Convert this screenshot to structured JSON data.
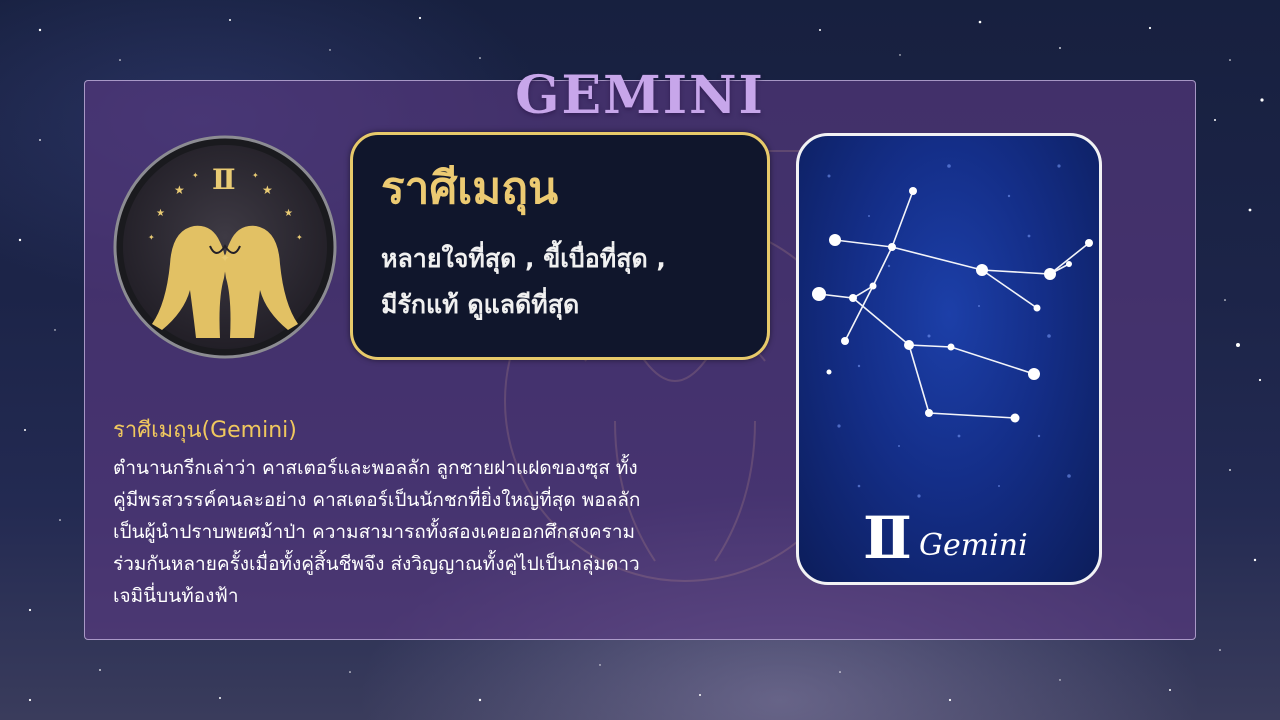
{
  "page": {
    "title": "GEMINI"
  },
  "traits_box": {
    "title": "ราศีเมถุน",
    "line1": "หลายใจที่สุด , ขี้เบื่อที่สุด ,",
    "line2": "มีรักแท้ ดูแลดีที่สุด"
  },
  "emblem": {
    "symbol": "♊"
  },
  "constellation_card": {
    "symbol": "Ⅱ",
    "name": "Gemini"
  },
  "description": {
    "heading": "ราศีเมถุน(Gemini)",
    "body": "ตำนานกรีกเล่าว่า คาสเตอร์และพอลลัก ลูกชายฝาแฝดของซุส ทั้ง\nคู่มีพรสวรรค์คนละอย่าง คาสเตอร์เป็นนักชกที่ยิ่งใหญ่ที่สุด พอลลัก\nเป็นผู้นำปราบพยศม้าป่า ความสามารถทั้งสองเคยออกศึกสงคราม\nร่วมกันหลายครั้งเมื่อทั้งคู่สิ้นชีพจึง ส่งวิญญาณทั้งคู่ไปเป็นกลุ่มดาว\nเจมินี่บนท้องฟ้า"
  },
  "colors": {
    "title": "#c7a6ea",
    "panel": "#5c3a82",
    "gold": "#ecca72",
    "card_blue": "#142e88"
  }
}
